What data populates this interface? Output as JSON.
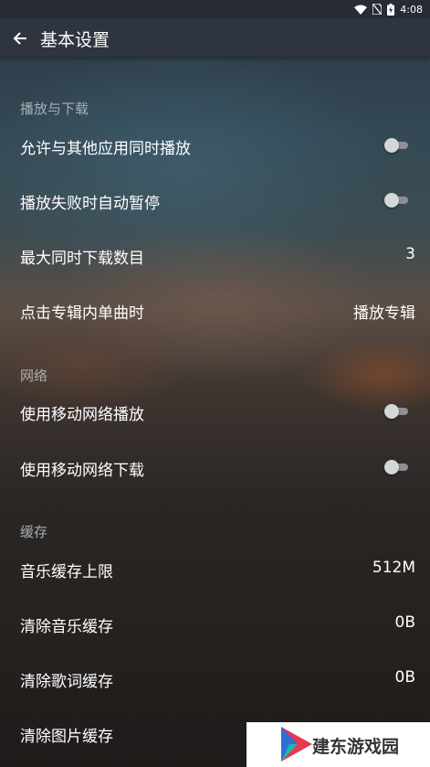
{
  "status_bar": {
    "time": "4:08",
    "icons": [
      "wifi-icon",
      "no-sim-icon",
      "battery-charging-icon"
    ]
  },
  "app_bar": {
    "title": "基本设置",
    "back_icon": "arrow-back-icon"
  },
  "sections": {
    "playback": {
      "title": "播放与下载",
      "allow_mix": {
        "label": "允许与其他应用同时播放",
        "enabled": false
      },
      "pause_on_fail": {
        "label": "播放失败时自动暂停",
        "enabled": false
      },
      "max_downloads": {
        "label": "最大同时下载数目",
        "value": "3"
      },
      "album_click": {
        "label": "点击专辑内单曲时",
        "value": "播放专辑"
      }
    },
    "network": {
      "title": "网络",
      "mobile_play": {
        "label": "使用移动网络播放",
        "enabled": false
      },
      "mobile_download": {
        "label": "使用移动网络下载",
        "enabled": false
      }
    },
    "cache": {
      "title": "缓存",
      "music_cache_limit": {
        "label": "音乐缓存上限",
        "value": "512M"
      },
      "clear_music": {
        "label": "清除音乐缓存",
        "value": "0B"
      },
      "clear_lyrics": {
        "label": "清除歌词缓存",
        "value": "0B"
      },
      "clear_images": {
        "label": "清除图片缓存"
      }
    }
  },
  "watermark": {
    "text": "建东游戏园",
    "colors": {
      "red": "#e8384f",
      "blue": "#2d6fd6",
      "teal": "#23b5a8"
    }
  }
}
